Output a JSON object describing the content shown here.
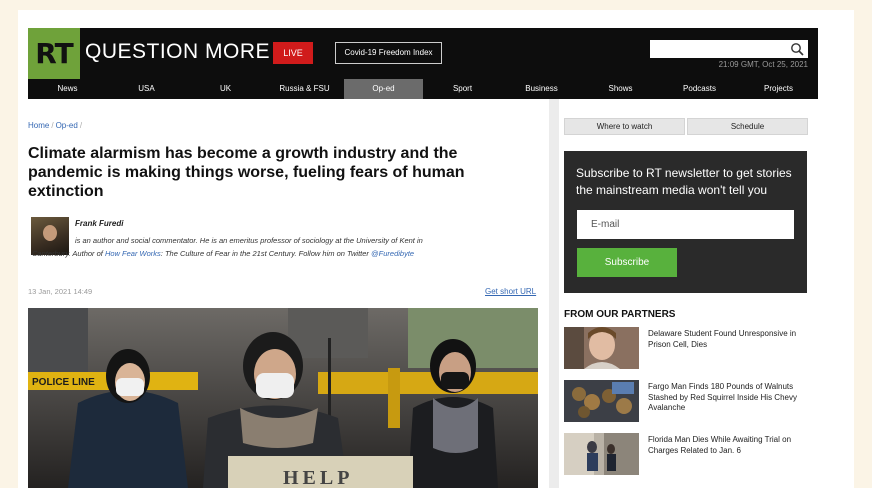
{
  "header": {
    "logo": "RT",
    "brand": "QUESTION MORE",
    "live_label": "LIVE",
    "covid_label": "Covid-19 Freedom Index",
    "search_placeholder": "",
    "datetime": "21:09 GMT, Oct 25, 2021",
    "colors": {
      "logo_green": "#6fa23a",
      "live_red": "#d01b1b",
      "bar": "#0d0d0d"
    }
  },
  "nav": [
    {
      "label": "News"
    },
    {
      "label": "USA"
    },
    {
      "label": "UK"
    },
    {
      "label": "Russia & FSU"
    },
    {
      "label": "Op-ed",
      "active": true
    },
    {
      "label": "Sport"
    },
    {
      "label": "Business"
    },
    {
      "label": "Shows"
    },
    {
      "label": "Podcasts"
    },
    {
      "label": "Projects"
    }
  ],
  "article": {
    "breadcrumb": [
      "Home",
      "Op-ed"
    ],
    "headline": "Climate alarmism has become a growth industry and the pandemic is making things worse, fueling fears of human extinction",
    "author_name": "Frank Furedi",
    "bio_1": "is an author and social commentator. He is an emeritus professor of sociology at the University of Kent in Canterbury. Author of ",
    "bio_link": "How Fear Works",
    "bio_2": ": The Culture of Fear in the 21st Century. Follow him on Twitter ",
    "bio_twitter": "@Furedibyte",
    "date": "13 Jan, 2021 14:49",
    "short_url": "Get short URL",
    "hero_sign_text": "HELP"
  },
  "sidebar": {
    "where_to_watch": "Where to watch",
    "schedule": "Schedule",
    "newsletter_title": "Subscribe to RT newsletter to get stories the mainstream media won't tell you",
    "email_placeholder": "E-mail",
    "subscribe_label": "Subscribe",
    "partners_title": "FROM OUR PARTNERS",
    "partners": [
      {
        "title": "Delaware Student Found Unresponsive in Prison Cell, Dies"
      },
      {
        "title": "Fargo Man Finds 180 Pounds of Walnuts Stashed by Red Squirrel Inside His Chevy Avalanche"
      },
      {
        "title": "Florida Man Dies While Awaiting Trial on Charges Related to Jan. 6"
      }
    ]
  }
}
